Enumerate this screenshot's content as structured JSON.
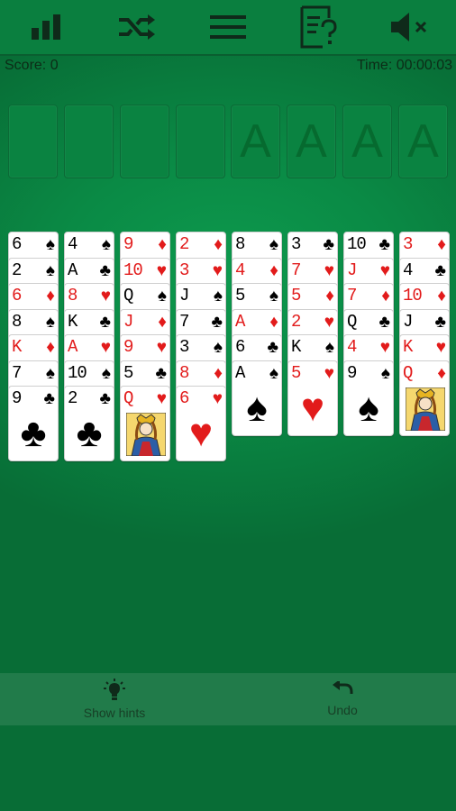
{
  "toolbar": {
    "buttons": [
      {
        "icon": "stats-icon"
      },
      {
        "icon": "shuffle-icon"
      },
      {
        "icon": "menu-icon"
      },
      {
        "icon": "rules-icon"
      },
      {
        "icon": "sound-muted-icon"
      }
    ]
  },
  "status": {
    "score": "Score: 0",
    "time": "Time: 00:00:03"
  },
  "free_cells": [
    "",
    "",
    "",
    ""
  ],
  "foundations": [
    "A",
    "A",
    "A",
    "A"
  ],
  "colors": {
    "red": "#e21b1b",
    "black": "#000000",
    "felt": "#0a8a45"
  },
  "tableau": [
    [
      {
        "r": "6",
        "s": "♠",
        "c": "black"
      },
      {
        "r": "2",
        "s": "♠",
        "c": "black"
      },
      {
        "r": "6",
        "s": "♦",
        "c": "red"
      },
      {
        "r": "8",
        "s": "♠",
        "c": "black"
      },
      {
        "r": "K",
        "s": "♦",
        "c": "red"
      },
      {
        "r": "7",
        "s": "♠",
        "c": "black"
      },
      {
        "r": "9",
        "s": "♣",
        "c": "black"
      }
    ],
    [
      {
        "r": "4",
        "s": "♠",
        "c": "black"
      },
      {
        "r": "A",
        "s": "♣",
        "c": "black"
      },
      {
        "r": "8",
        "s": "♥",
        "c": "red"
      },
      {
        "r": "K",
        "s": "♣",
        "c": "black"
      },
      {
        "r": "A",
        "s": "♥",
        "c": "red"
      },
      {
        "r": "10",
        "s": "♠",
        "c": "black"
      },
      {
        "r": "2",
        "s": "♣",
        "c": "black"
      }
    ],
    [
      {
        "r": "9",
        "s": "♦",
        "c": "red"
      },
      {
        "r": "10",
        "s": "♥",
        "c": "red"
      },
      {
        "r": "Q",
        "s": "♠",
        "c": "black"
      },
      {
        "r": "J",
        "s": "♦",
        "c": "red"
      },
      {
        "r": "9",
        "s": "♥",
        "c": "red"
      },
      {
        "r": "5",
        "s": "♣",
        "c": "black"
      },
      {
        "r": "Q",
        "s": "♥",
        "c": "red"
      }
    ],
    [
      {
        "r": "2",
        "s": "♦",
        "c": "red"
      },
      {
        "r": "3",
        "s": "♥",
        "c": "red"
      },
      {
        "r": "J",
        "s": "♠",
        "c": "black"
      },
      {
        "r": "7",
        "s": "♣",
        "c": "black"
      },
      {
        "r": "3",
        "s": "♠",
        "c": "black"
      },
      {
        "r": "8",
        "s": "♦",
        "c": "red"
      },
      {
        "r": "6",
        "s": "♥",
        "c": "red"
      }
    ],
    [
      {
        "r": "8",
        "s": "♠",
        "c": "black"
      },
      {
        "r": "4",
        "s": "♦",
        "c": "red"
      },
      {
        "r": "5",
        "s": "♠",
        "c": "black"
      },
      {
        "r": "A",
        "s": "♦",
        "c": "red"
      },
      {
        "r": "6",
        "s": "♣",
        "c": "black"
      },
      {
        "r": "A",
        "s": "♠",
        "c": "black"
      }
    ],
    [
      {
        "r": "3",
        "s": "♣",
        "c": "black"
      },
      {
        "r": "7",
        "s": "♥",
        "c": "red"
      },
      {
        "r": "5",
        "s": "♦",
        "c": "red"
      },
      {
        "r": "2",
        "s": "♥",
        "c": "red"
      },
      {
        "r": "K",
        "s": "♠",
        "c": "black"
      },
      {
        "r": "5",
        "s": "♥",
        "c": "red"
      }
    ],
    [
      {
        "r": "10",
        "s": "♣",
        "c": "black"
      },
      {
        "r": "J",
        "s": "♥",
        "c": "red"
      },
      {
        "r": "7",
        "s": "♦",
        "c": "red"
      },
      {
        "r": "Q",
        "s": "♣",
        "c": "black"
      },
      {
        "r": "4",
        "s": "♥",
        "c": "red"
      },
      {
        "r": "9",
        "s": "♠",
        "c": "black"
      }
    ],
    [
      {
        "r": "3",
        "s": "♦",
        "c": "red"
      },
      {
        "r": "4",
        "s": "♣",
        "c": "black"
      },
      {
        "r": "10",
        "s": "♦",
        "c": "red"
      },
      {
        "r": "J",
        "s": "♣",
        "c": "black"
      },
      {
        "r": "K",
        "s": "♥",
        "c": "red"
      },
      {
        "r": "Q",
        "s": "♦",
        "c": "red"
      }
    ]
  ],
  "bottom": {
    "hints_label": "Show hints",
    "undo_label": "Undo"
  }
}
